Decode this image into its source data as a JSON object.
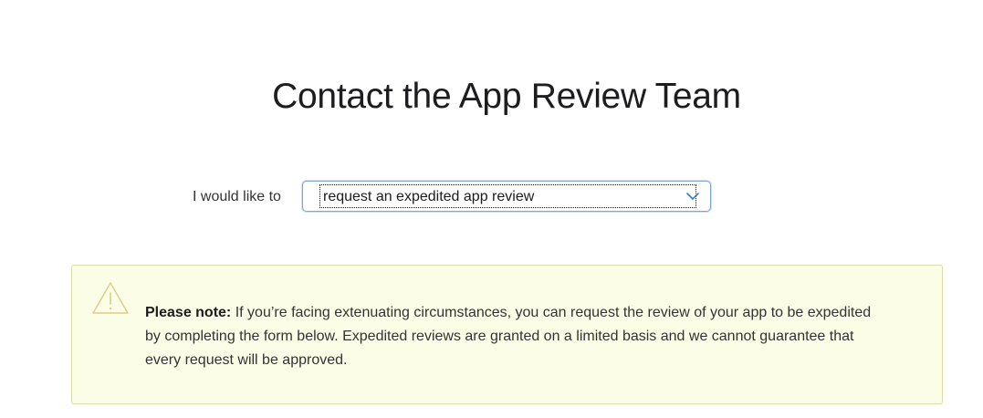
{
  "page": {
    "title": "Contact the App Review Team"
  },
  "topic": {
    "label": "I would like to",
    "selected": "request an expedited app review"
  },
  "notice": {
    "lead": "Please note:",
    "body": " If you’re facing extenuating circumstances, you can request the review of your app to be expedited by completing the form below. Expedited reviews are granted on a limited basis and we cannot guarantee that every request will be approved."
  },
  "icons": {
    "select": "chevron-down-icon",
    "notice": "warning-icon"
  },
  "colors": {
    "notice_background": "#fbfde7",
    "notice_border": "#d9dca6",
    "select_focus": "#7aa7d8",
    "text": "#1d1d1f"
  }
}
